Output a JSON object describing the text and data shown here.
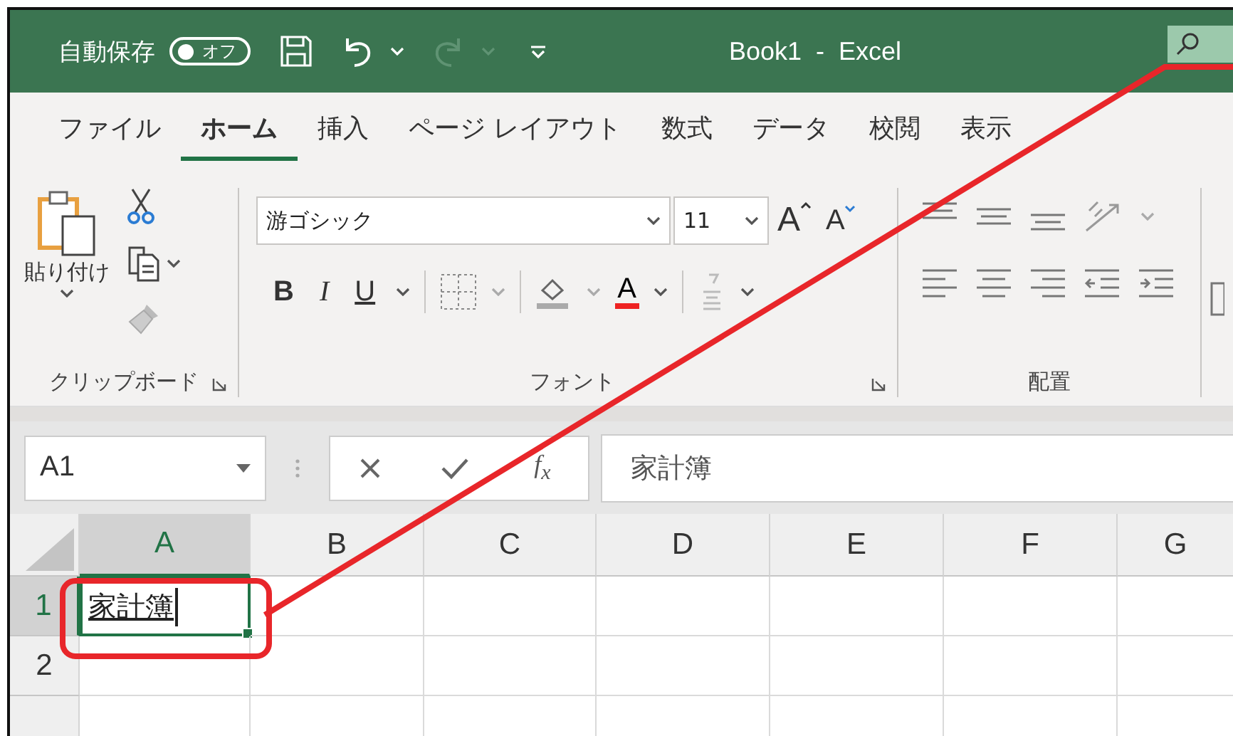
{
  "title_bar": {
    "autosave_label": "自動保存",
    "autosave_toggle": {
      "label": "オフ",
      "on": false
    },
    "redo": {
      "disabled": true
    },
    "title": "Book1  -  Excel"
  },
  "tabs": [
    {
      "label": "ファイル",
      "selected": false
    },
    {
      "label": "ホーム",
      "selected": true
    },
    {
      "label": "挿入",
      "selected": false
    },
    {
      "label": "ページ レイアウト",
      "selected": false
    },
    {
      "label": "数式",
      "selected": false
    },
    {
      "label": "データ",
      "selected": false
    },
    {
      "label": "校閲",
      "selected": false
    },
    {
      "label": "表示",
      "selected": false
    }
  ],
  "ribbon": {
    "clipboard": {
      "paste_label": "貼り付け",
      "group_label": "クリップボード"
    },
    "font": {
      "font_name": "游ゴシック",
      "font_size": "11",
      "grow_label": "A",
      "shrink_label": "A",
      "bold_label": "B",
      "italic_label": "I",
      "underline_label": "U",
      "font_color_label": "A",
      "group_label": "フォント"
    },
    "alignment": {
      "group_label": "配置"
    }
  },
  "formula_bar": {
    "name_box": "A1",
    "function_label": "f$_{x}$",
    "content": "家計簿"
  },
  "sheet": {
    "columns": [
      {
        "label": "A",
        "selected": true
      },
      {
        "label": "B",
        "selected": false
      },
      {
        "label": "C",
        "selected": false
      },
      {
        "label": "D",
        "selected": false
      },
      {
        "label": "E",
        "selected": false
      },
      {
        "label": "F",
        "selected": false
      },
      {
        "label": "G",
        "selected": false
      }
    ],
    "rows": [
      {
        "label": "1",
        "selected": true,
        "value": "家計簿"
      },
      {
        "label": "2",
        "selected": false
      }
    ]
  }
}
